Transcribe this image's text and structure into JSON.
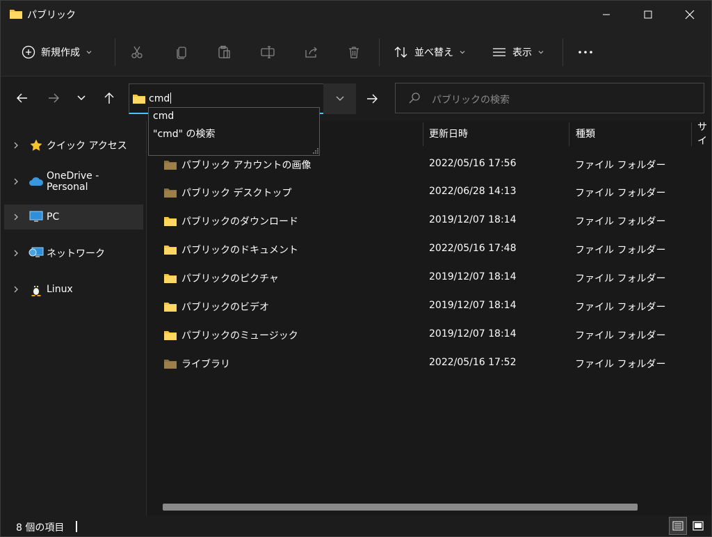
{
  "window": {
    "title": "パブリック",
    "controls": {
      "minimize": "minimize-icon",
      "maximize": "maximize-icon",
      "close": "close-icon"
    }
  },
  "toolbar": {
    "new_label": "新規作成",
    "sort_label": "並べ替え",
    "view_label": "表示",
    "icons": [
      "plus-circle-icon",
      "cut-icon",
      "copy-icon",
      "paste-icon",
      "rename-icon",
      "share-icon",
      "delete-icon",
      "sort-icon",
      "view-icon",
      "more-icon"
    ]
  },
  "address": {
    "value": "cmd",
    "search_placeholder": "パブリックの検索"
  },
  "autocomplete": {
    "items": [
      "cmd",
      "\"cmd\" の検索"
    ]
  },
  "sidebar": {
    "items": [
      {
        "label": "クイック アクセス",
        "icon": "star-icon"
      },
      {
        "label": "OneDrive - Personal",
        "icon": "cloud-icon"
      },
      {
        "label": "PC",
        "icon": "monitor-icon",
        "selected": true
      },
      {
        "label": "ネットワーク",
        "icon": "network-icon"
      },
      {
        "label": "Linux",
        "icon": "penguin-icon"
      }
    ]
  },
  "columns": {
    "date": "更新日時",
    "type": "種類",
    "size": "サイ"
  },
  "files": [
    {
      "name": "パブリック アカウントの画像",
      "date": "2022/05/16 17:56",
      "type": "ファイル フォルダー",
      "icon": "folder-dark-icon"
    },
    {
      "name": "パブリック デスクトップ",
      "date": "2022/06/28 14:13",
      "type": "ファイル フォルダー",
      "icon": "folder-dark-icon"
    },
    {
      "name": "パブリックのダウンロード",
      "date": "2019/12/07 18:14",
      "type": "ファイル フォルダー",
      "icon": "folder-icon"
    },
    {
      "name": "パブリックのドキュメント",
      "date": "2022/05/16 17:48",
      "type": "ファイル フォルダー",
      "icon": "folder-icon"
    },
    {
      "name": "パブリックのピクチャ",
      "date": "2019/12/07 18:14",
      "type": "ファイル フォルダー",
      "icon": "folder-icon"
    },
    {
      "name": "パブリックのビデオ",
      "date": "2019/12/07 18:14",
      "type": "ファイル フォルダー",
      "icon": "folder-icon"
    },
    {
      "name": "パブリックのミュージック",
      "date": "2019/12/07 18:14",
      "type": "ファイル フォルダー",
      "icon": "folder-icon"
    },
    {
      "name": "ライブラリ",
      "date": "2022/05/16 17:52",
      "type": "ファイル フォルダー",
      "icon": "folder-dark-icon"
    }
  ],
  "status": {
    "item_count": "8 個の項目"
  },
  "colors": {
    "accent": "#4cc2ff",
    "folder": "#f6c343",
    "folder_dark": "#8a7040",
    "background": "#191919"
  }
}
